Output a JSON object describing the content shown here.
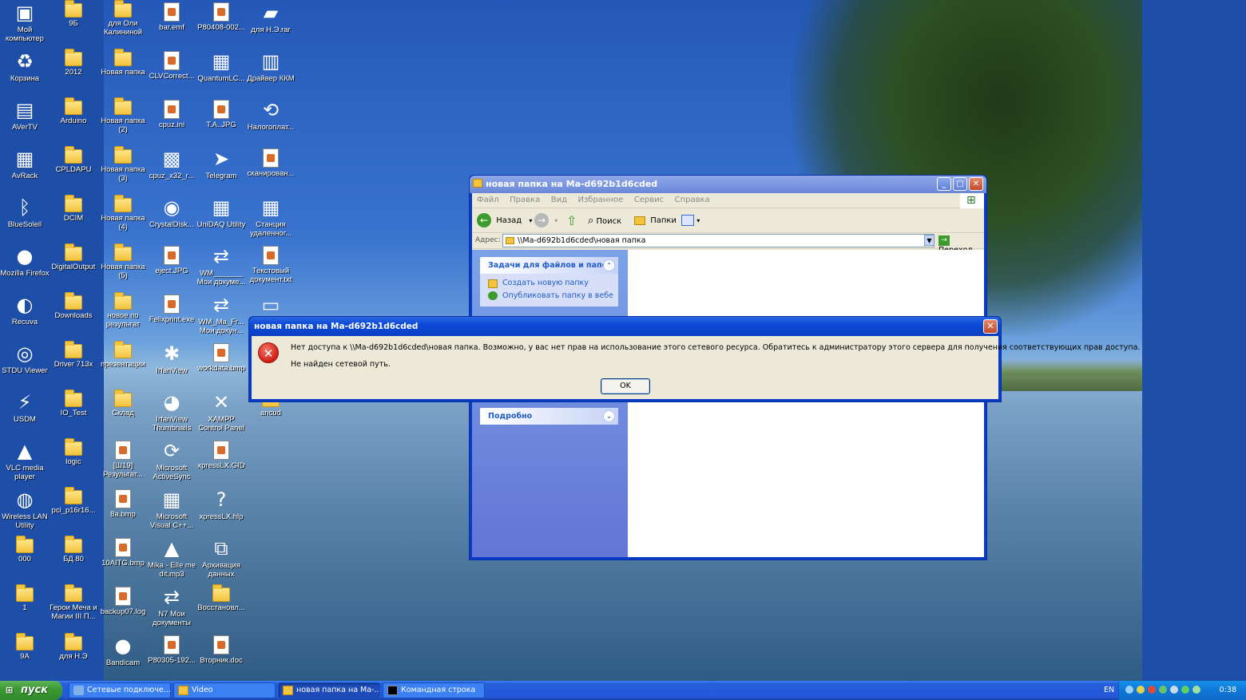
{
  "desktop": {
    "icons": [
      {
        "label": "Мой компьютер",
        "icon": "my-computer-icon"
      },
      {
        "label": "9Б",
        "icon": "folder-icon"
      },
      {
        "label": "для Оли Калининой",
        "icon": "folder-icon"
      },
      {
        "label": "bar.emf",
        "icon": "image-file-icon"
      },
      {
        "label": "P80408-002...",
        "icon": "image-file-icon"
      },
      {
        "label": "для Н.Э.rar",
        "icon": "archive-icon"
      },
      {
        "label": "Корзина",
        "icon": "recycle-bin-icon"
      },
      {
        "label": "2012",
        "icon": "folder-icon"
      },
      {
        "label": "Новая папка",
        "icon": "folder-icon"
      },
      {
        "label": "CLVCorrect...",
        "icon": "image-file-icon"
      },
      {
        "label": "QuantumLC...",
        "icon": "app-icon"
      },
      {
        "label": "Драйвер ККМ",
        "icon": "barcode-icon"
      },
      {
        "label": "AVerTV",
        "icon": "film-icon"
      },
      {
        "label": "Arduino",
        "icon": "folder-icon"
      },
      {
        "label": "Новая папка (2)",
        "icon": "folder-icon"
      },
      {
        "label": "cpuz.ini",
        "icon": "settings-file-icon"
      },
      {
        "label": "T.A..JPG",
        "icon": "image-file-icon"
      },
      {
        "label": "Налогоплат...",
        "icon": "sync-icon"
      },
      {
        "label": "AvRack",
        "icon": "app-icon"
      },
      {
        "label": "CPLDAPU",
        "icon": "folder-icon"
      },
      {
        "label": "Новая папка (3)",
        "icon": "folder-icon"
      },
      {
        "label": "cpuz_x32_r...",
        "icon": "chip-icon"
      },
      {
        "label": "Telegram",
        "icon": "telegram-icon"
      },
      {
        "label": "сканирован...",
        "icon": "pdf-icon"
      },
      {
        "label": "BlueSoleil",
        "icon": "bluetooth-icon"
      },
      {
        "label": "DCIM",
        "icon": "folder-icon"
      },
      {
        "label": "Новая папка (4)",
        "icon": "folder-icon"
      },
      {
        "label": "CrystalDisk...",
        "icon": "disk-icon"
      },
      {
        "label": "UniDAQ Utility",
        "icon": "app-icon"
      },
      {
        "label": "Станция удаленног...",
        "icon": "app-icon"
      },
      {
        "label": "Mozilla Firefox",
        "icon": "firefox-icon"
      },
      {
        "label": "DigitalOutput",
        "icon": "folder-icon"
      },
      {
        "label": "Новая папка (5)",
        "icon": "folder-icon"
      },
      {
        "label": "eject.JPG",
        "icon": "image-file-icon"
      },
      {
        "label": "WM_______ Мои докуме...",
        "icon": "shared-folder-icon"
      },
      {
        "label": "Текстовый документ.txt",
        "icon": "text-file-icon"
      },
      {
        "label": "Recuva",
        "icon": "recuva-icon"
      },
      {
        "label": "Downloads",
        "icon": "folder-icon"
      },
      {
        "label": "новое по результат",
        "icon": "folder-icon"
      },
      {
        "label": "Felixprint.exe",
        "icon": "document-icon"
      },
      {
        "label": "WM_Ma_Fr... Мои докун...",
        "icon": "shared-folder-icon"
      },
      {
        "label": "",
        "icon": "drive-icon"
      },
      {
        "label": "STDU Viewer",
        "icon": "viewer-icon"
      },
      {
        "label": "Driver 713x",
        "icon": "folder-icon"
      },
      {
        "label": "презентации",
        "icon": "folder-icon"
      },
      {
        "label": "IrfanView",
        "icon": "irfanview-icon"
      },
      {
        "label": "workdata.bmp",
        "icon": "image-file-icon"
      },
      {
        "label": "",
        "icon": "none"
      },
      {
        "label": "USDM",
        "icon": "lightning-icon"
      },
      {
        "label": "IO_Test",
        "icon": "folder-icon"
      },
      {
        "label": "Склад",
        "icon": "folder-icon"
      },
      {
        "label": "IrfanView Thumbnails",
        "icon": "panda-icon"
      },
      {
        "label": "XAMPP Control Panel",
        "icon": "xampp-icon"
      },
      {
        "label": "ancud",
        "icon": "folder-icon"
      },
      {
        "label": "VLC media player",
        "icon": "vlc-icon"
      },
      {
        "label": "logic",
        "icon": "folder-icon"
      },
      {
        "label": "[Ш19] Результат...",
        "icon": "document-icon"
      },
      {
        "label": "Microsoft ActiveSync",
        "icon": "activesync-icon"
      },
      {
        "label": "xpressLX.GID",
        "icon": "file-icon"
      },
      {
        "label": "",
        "icon": "none"
      },
      {
        "label": "Wireless LAN Utility",
        "icon": "wireless-icon"
      },
      {
        "label": "pci_p16r16...",
        "icon": "folder-icon"
      },
      {
        "label": "8a.bmp",
        "icon": "image-file-icon"
      },
      {
        "label": "Microsoft Visual C++...",
        "icon": "app-icon"
      },
      {
        "label": "xpressLX.hlp",
        "icon": "help-icon"
      },
      {
        "label": "",
        "icon": "none"
      },
      {
        "label": "000",
        "icon": "folder-icon"
      },
      {
        "label": "БД 80",
        "icon": "folder-icon"
      },
      {
        "label": "10AITG.bmp",
        "icon": "image-file-icon"
      },
      {
        "label": "Mika - Elle me dit.mp3",
        "icon": "vlc-icon"
      },
      {
        "label": "Архивация данных",
        "icon": "backup-icon"
      },
      {
        "label": "",
        "icon": "none"
      },
      {
        "label": "1",
        "icon": "folder-icon"
      },
      {
        "label": "Герои Меча и Магии III П...",
        "icon": "folder-icon"
      },
      {
        "label": "backup07.log",
        "icon": "text-file-icon"
      },
      {
        "label": "N7 Мои документы",
        "icon": "shared-folder-icon"
      },
      {
        "label": "Восстановл...",
        "icon": "folder-icon"
      },
      {
        "label": "",
        "icon": "none"
      },
      {
        "label": "9А",
        "icon": "folder-icon"
      },
      {
        "label": "для Н.Э",
        "icon": "folder-icon"
      },
      {
        "label": "Bandicam",
        "icon": "bandicam-icon"
      },
      {
        "label": "P80305-192...",
        "icon": "image-file-icon"
      },
      {
        "label": "Вторник.doc",
        "icon": "word-icon"
      },
      {
        "label": "",
        "icon": "none"
      }
    ]
  },
  "explorer": {
    "title": "новая папка на Ma-d692b1d6cded",
    "menu": [
      "Файл",
      "Правка",
      "Вид",
      "Избранное",
      "Сервис",
      "Справка"
    ],
    "toolbar": {
      "back": "Назад",
      "search": "Поиск",
      "folders": "Папки"
    },
    "address": {
      "label": "Адрес:",
      "value": "\\\\Ma-d692b1d6cded\\новая папка",
      "go": "Переход"
    },
    "tasks": {
      "header": "Задачи для файлов и папок",
      "links": [
        "Создать новую папку",
        "Опубликовать папку в вебе"
      ]
    },
    "details": {
      "header": "Подробно"
    }
  },
  "dialog": {
    "title": "новая папка на Ma-d692b1d6cded",
    "message": "Нет доступа к \\\\Ma-d692b1d6cded\\новая папка. Возможно, у вас нет прав на использование этого сетевого ресурса. Обратитесь к администратору этого сервера для получения соответствующих прав доступа.",
    "detail": "Не найден сетевой путь.",
    "ok": "OK"
  },
  "taskbar": {
    "start": "пуск",
    "buttons": [
      {
        "label": "Сетевые подключе..."
      },
      {
        "label": "Video"
      },
      {
        "label": "новая папка на Ma-..."
      },
      {
        "label": "Командная строка"
      }
    ],
    "lang": "EN",
    "clock": "0:38"
  },
  "colors": {
    "xp_blue": "#0a3bc7",
    "error_red": "#d21e14",
    "start_green": "#3c9b33"
  }
}
